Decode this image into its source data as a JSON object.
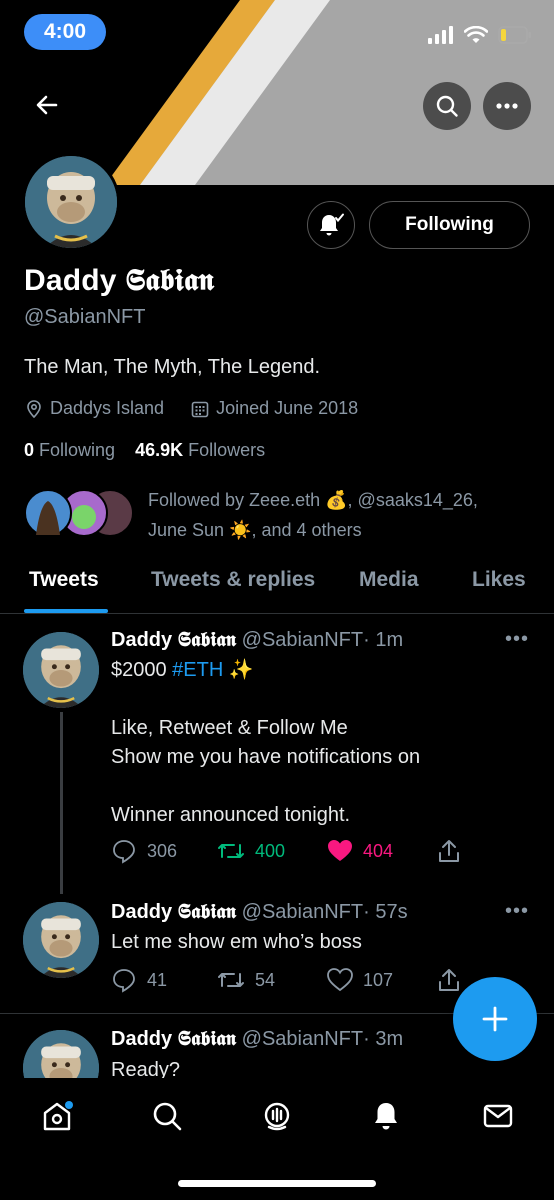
{
  "status_bar": {
    "time": "4:00"
  },
  "profile": {
    "display_name": "Daddy 𝕾𝖆𝖇𝖎𝖆𝖓",
    "handle": "@SabianNFT",
    "bio": "The Man, The Myth, The Legend.",
    "location": "Daddys Island",
    "joined": "Joined June 2018",
    "following_count": "0",
    "following_label": "Following",
    "followers_count": "46.9K",
    "followers_label": "Followers",
    "followed_by_prefix": "Followed by Zeee.eth",
    "followed_by_mid": ", @saaks14_26,",
    "followed_by_line2a": "June Sun",
    "followed_by_line2b": ", and 4 others",
    "follow_button": "Following"
  },
  "tabs": [
    {
      "label": "Tweets",
      "active": true
    },
    {
      "label": "Tweets & replies",
      "active": false
    },
    {
      "label": "Media",
      "active": false
    },
    {
      "label": "Likes",
      "active": false
    }
  ],
  "tweets": [
    {
      "name": "Daddy 𝕾𝖆𝖇𝖎𝖆𝖓",
      "handle": "@SabianNFT",
      "time": "· 1m",
      "text_line1_prefix": "$2000 ",
      "text_line1_tag": "#ETH",
      "text_line1_suffix": " ✨",
      "text_line2": "Like, Retweet & Follow Me",
      "text_line3": "Show me you have notifications on",
      "text_line4": "Winner announced tonight.",
      "replies": "306",
      "retweets": "400",
      "likes": "404"
    },
    {
      "name": "Daddy 𝕾𝖆𝖇𝖎𝖆𝖓",
      "handle": "@SabianNFT",
      "time": "· 57s",
      "text": "Let me show em who’s boss",
      "replies": "41",
      "retweets": "54",
      "likes": "107"
    },
    {
      "name": "Daddy 𝕾𝖆𝖇𝖎𝖆𝖓",
      "handle": "@SabianNFT",
      "time": "· 3m",
      "text": "Ready?"
    }
  ],
  "colors": {
    "accent": "#1d9bf0",
    "retweet_green": "#00ba7c",
    "like_pink": "#f91880",
    "secondary_text": "#8b98a5"
  }
}
